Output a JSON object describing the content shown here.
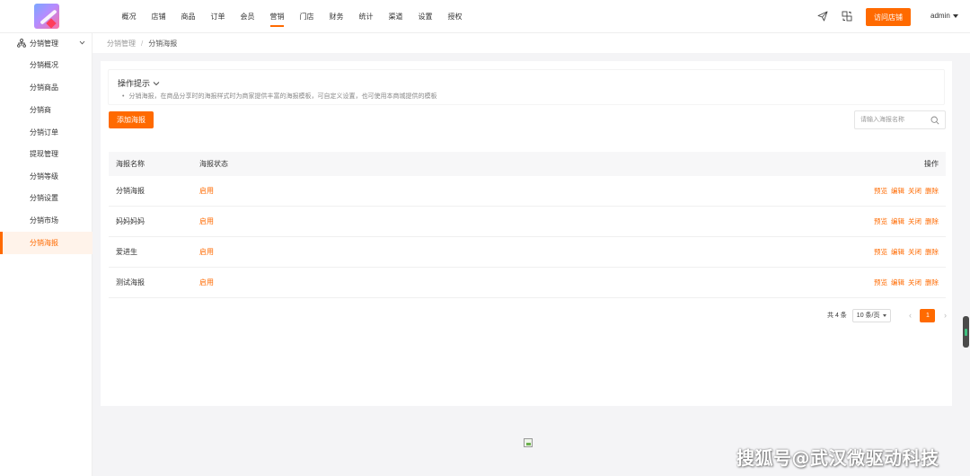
{
  "topbar": {
    "nav": [
      "概况",
      "店铺",
      "商品",
      "订单",
      "会员",
      "营销",
      "门店",
      "财务",
      "统计",
      "渠道",
      "设置",
      "授权"
    ],
    "active_nav": "营销",
    "visit_store_label": "访问店铺",
    "user_name": "admin"
  },
  "sidebar": {
    "group_title": "分销管理",
    "items": [
      "分销概况",
      "分销商品",
      "分销商",
      "分销订单",
      "提现管理",
      "分销等级",
      "分销设置",
      "分销市场",
      "分销海报"
    ],
    "active_item": "分销海报"
  },
  "breadcrumb": {
    "parent": "分销管理",
    "separator": "/",
    "current": "分销海报"
  },
  "tips": {
    "title": "操作提示",
    "text": "分销海报，在商品分享时的海报样式时为商家提供丰富的海报模板，可自定义设置，也可使用本商城提供的模板"
  },
  "toolbar": {
    "add_label": "添加海报",
    "search_placeholder": "请输入海报名称"
  },
  "table": {
    "headers": {
      "name": "海报名称",
      "status": "海报状态",
      "ops": "操作"
    },
    "rows": [
      {
        "name": "分销海报",
        "status": "启用",
        "ops": [
          "预览",
          "编辑",
          "关闭",
          "删除"
        ]
      },
      {
        "name": "妈妈妈妈",
        "status": "启用",
        "ops": [
          "预览",
          "编辑",
          "关闭",
          "删除"
        ]
      },
      {
        "name": "爱进生",
        "status": "启用",
        "ops": [
          "预览",
          "编辑",
          "关闭",
          "删除"
        ]
      },
      {
        "name": "测试海报",
        "status": "启用",
        "ops": [
          "预览",
          "编辑",
          "关闭",
          "删除"
        ]
      }
    ]
  },
  "pagination": {
    "total_label": "共 4 条",
    "page_size_label": "10 条/页",
    "prev": "‹",
    "current_page": "1",
    "next": "›"
  },
  "watermark": "搜狐号@武汉微驱动科技",
  "colors": {
    "accent": "#ff6a00",
    "background": "#f4f4f6"
  }
}
